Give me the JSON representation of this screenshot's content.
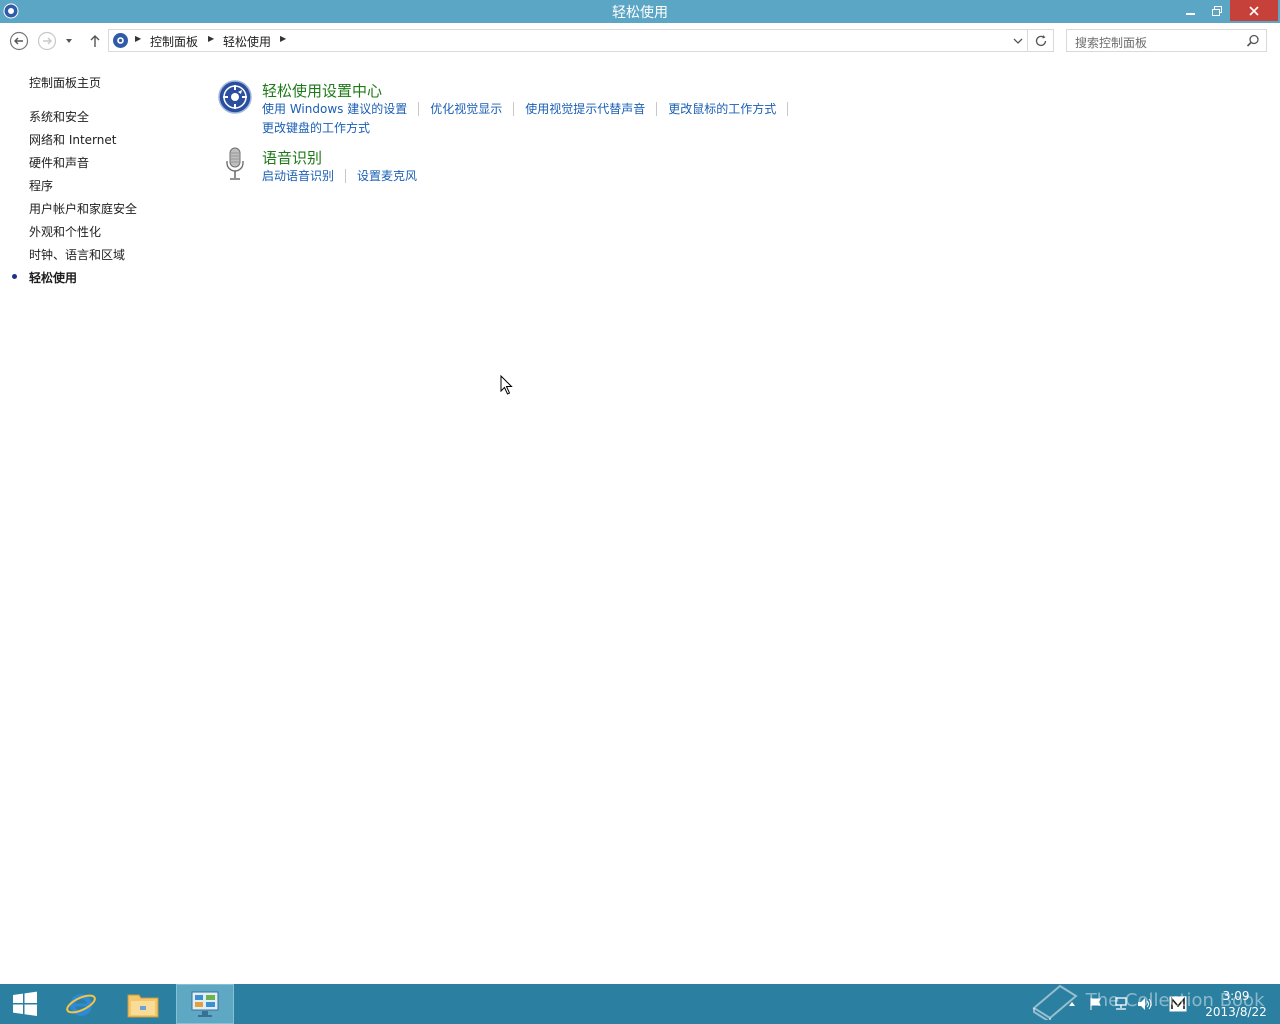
{
  "window": {
    "title": "轻松使用"
  },
  "nav": {
    "breadcrumbs": [
      "控制面板",
      "轻松使用"
    ],
    "search_placeholder": "搜索控制面板"
  },
  "sidebar": {
    "home": "控制面板主页",
    "items": [
      {
        "label": "系统和安全"
      },
      {
        "label": "网络和 Internet"
      },
      {
        "label": "硬件和声音"
      },
      {
        "label": "程序"
      },
      {
        "label": "用户帐户和家庭安全"
      },
      {
        "label": "外观和个性化"
      },
      {
        "label": "时钟、语言和区域"
      },
      {
        "label": "轻松使用",
        "active": true
      }
    ]
  },
  "sections": [
    {
      "icon": "ease-of-access-icon",
      "heading": "轻松使用设置中心",
      "links_row1": [
        "使用 Windows 建议的设置",
        "优化视觉显示",
        "使用视觉提示代替声音",
        "更改鼠标的工作方式"
      ],
      "links_row2": [
        "更改键盘的工作方式"
      ]
    },
    {
      "icon": "microphone-icon",
      "heading": "语音识别",
      "links_row1": [
        "启动语音识别",
        "设置麦克风"
      ]
    }
  ],
  "taskbar": {
    "clock_time": "3:09",
    "clock_date": "2013/8/22",
    "watermark": "The Collection Book"
  },
  "colors": {
    "titlebar": "#5ba6c4",
    "taskbar": "#2b7fa0",
    "heading_green": "#1e7a18",
    "link_blue": "#1a5fb4",
    "close_red": "#c7413b"
  }
}
